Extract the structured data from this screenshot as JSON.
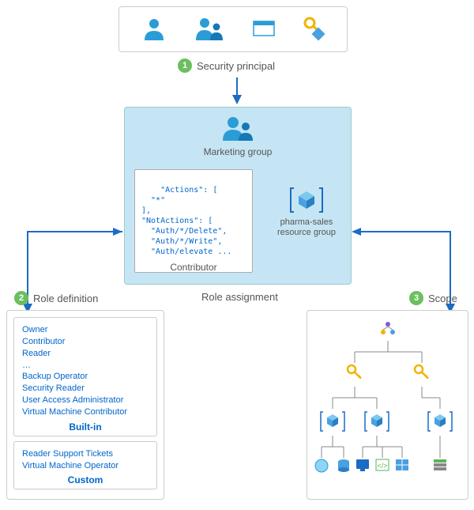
{
  "sections": {
    "security_principal": "Security principal",
    "role_definition": "Role definition",
    "role_assignment": "Role assignment",
    "scope": "Scope"
  },
  "center": {
    "group_name": "Marketing group",
    "contributor_label": "Contributor",
    "resource_group_line1": "pharma-sales",
    "resource_group_line2": "resource group",
    "code": "\"Actions\": [\n  \"*\"\n],\n\"NotActions\": [\n  \"Auth/*/Delete\",\n  \"Auth/*/Write\",\n  \"Auth/elevate ..."
  },
  "roles": {
    "builtin_label": "Built-in",
    "builtin": [
      "Owner",
      "Contributor",
      "Reader",
      "…",
      "Backup Operator",
      "Security Reader",
      "User Access Administrator",
      "Virtual Machine Contributor"
    ],
    "custom_label": "Custom",
    "custom": [
      "Reader Support Tickets",
      "Virtual Machine Operator"
    ]
  },
  "icons": {
    "user": "user-icon",
    "group": "group-icon",
    "app": "app-icon",
    "key": "key-icon",
    "cube": "cube-bracket-icon",
    "hierarchy": "hierarchy-icon"
  }
}
